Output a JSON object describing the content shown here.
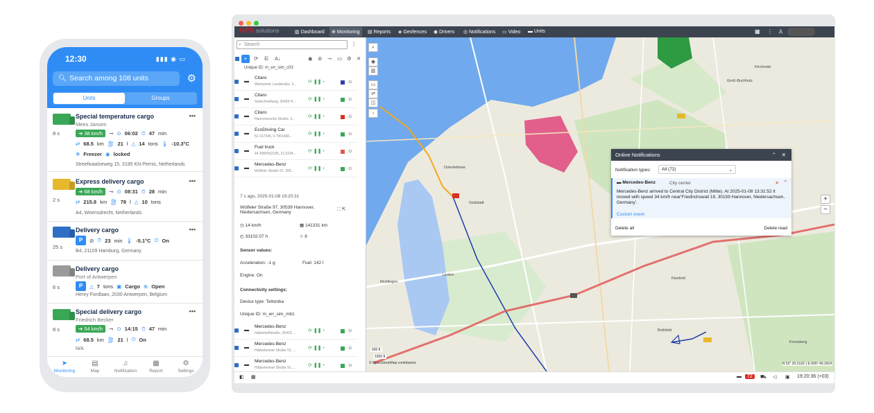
{
  "phone": {
    "time": "12:30",
    "search_placeholder": "Search among 108 units",
    "tabs": [
      "Units",
      "Groups"
    ],
    "cards": [
      {
        "title": "Special temperature cargo",
        "sub": "Mees Jansen",
        "age": "8 s",
        "color": "#3aa756",
        "r1": {
          "speed": "38 km/h",
          "time": "06:02",
          "dur": "47",
          "dur_unit": "min"
        },
        "r2": {
          "dist": "68.5",
          "dist_unit": "km",
          "fuel": "21",
          "fuel_unit": "l",
          "weight": "14",
          "weight_unit": "tons",
          "temp": "-10.3°C"
        },
        "r3": {
          "a": "Freezer",
          "b": "locked"
        },
        "addr": "Streefwaalseweg 15, 3195 KN Pernis, Netherlands"
      },
      {
        "title": "Express delivery cargo",
        "age": "2 s",
        "color": "#e7b82c",
        "r1": {
          "speed": "68 km/h",
          "time": "08:31",
          "dur": "28",
          "dur_unit": "min"
        },
        "r2": {
          "dist": "215.8",
          "dist_unit": "km",
          "fuel": "78",
          "fuel_unit": "l",
          "weight": "10",
          "weight_unit": "tons"
        },
        "addr": "A4, Woensdrecht, Netherlands"
      },
      {
        "title": "Delivery cargo",
        "age": "25 s",
        "color": "#2f6fc5",
        "r1": {
          "park": "P",
          "dur": "23",
          "dur_unit": "min",
          "temp": "-5.1°C",
          "on": "On"
        },
        "addr": "B4, 21109 Hamburg, Germany"
      },
      {
        "title": "Delivery cargo",
        "sub": "Port of Antwerpen",
        "age": "6 s",
        "color": "#9a9a9a",
        "r1": {
          "park": "P",
          "weight": "7",
          "weight_unit": "tons",
          "cargo": "Cargo",
          "open": "Open"
        },
        "addr": "Henry Fordlaan, 2030 Antwerpen, Belgium"
      },
      {
        "title": "Special delivery cargo",
        "sub": "Friedrich Becker",
        "age": "8 s",
        "color": "#3aa756",
        "r1": {
          "speed": "54 km/h",
          "time": "14:15",
          "dur": "47",
          "dur_unit": "min"
        },
        "r2": {
          "dist": "68.5",
          "dist_unit": "km",
          "fuel": "21",
          "fuel_unit": "l",
          "on": "On"
        },
        "addr": "N/A"
      }
    ],
    "nav": [
      "Monitoring",
      "Map",
      "Notification",
      "Report",
      "Settings"
    ]
  },
  "desktop": {
    "logo_a": "GPS",
    "logo_b": "solutions",
    "menu": [
      "Dashboard",
      "Monitoring",
      "Reports",
      "Geofences",
      "Drivers",
      "Notifications",
      "Video",
      "Units"
    ],
    "search_placeholder": "Search",
    "unique_top": "Unique ID: m_en_sim_c03",
    "units": [
      {
        "name": "Citaro",
        "sub": "Weetzener Landstraße, 3...",
        "sq": "#2f3fa8"
      },
      {
        "name": "Citaro",
        "sub": "Südschnellweg, 30459 H...",
        "sq": "#3aa756"
      },
      {
        "name": "Citaro",
        "sub": "Hannoversche Straße, 3...",
        "sq": "#d93025"
      },
      {
        "name": "EcoDriving Car",
        "sub": "52.317345, 9.7951666...",
        "sq": "#3aa756"
      },
      {
        "name": "Fuel truck",
        "sub": "44.4950552185, 21.0234...",
        "sq": "#e05a4a"
      },
      {
        "name": "Mercedes-Benz",
        "sub": "Wülfeler Straße 97, 305...",
        "sq": "#3aa756"
      }
    ],
    "detail": {
      "ago": "7 s ago, 2025-01-08 19:20:31",
      "address": "Wülfeler Straße 97, 30539 Hannover, Niedersachsen, Germany",
      "speed": "14 km/h",
      "odometer": "141331 km",
      "hours": "33102.07 h",
      "sats": "8",
      "sensor_title": "Sensor values:",
      "accel": "Acceleration: -1 g",
      "fuel": "Fuel: 142 l",
      "engine": "Engine: On",
      "conn_title": "Connectivity settings:",
      "device": "Device type: Teltonika",
      "uid": "Unique ID: m_en_sim_mb1"
    },
    "units2": [
      {
        "name": "Mercedes-Benz",
        "sub": "Haltenhoffstraße, 30419 ...",
        "sq": "#3aa756"
      },
      {
        "name": "Mercedes-Benz",
        "sub": "Hildesheimer Straße 91, ...",
        "sq": "#3aa756"
      },
      {
        "name": "Mercedes-Benz",
        "sub": "Hildesheimer Straße 91, ...",
        "sq": "#3aa756"
      },
      {
        "name": "Mercedes-Benz",
        "sub": "",
        "sq": "#3aa756"
      }
    ],
    "notif": {
      "title": "Online Notifications",
      "types_label": "Notification types:",
      "types_value": "All (72)",
      "unit": "Mercedes-Benz",
      "tag": "City center",
      "text": "Mercedes-Benz arrived to Central City District (Mitte). At 2025-01-08 13:31:52 it moved with speed 34 km/h near'Friedrichswall 19, 30159 Hannover, Niedersachsen, Germany'.",
      "custom": "Custom event",
      "delete_all": "Delete all",
      "delete_read": "Delete read"
    },
    "map_labels": [
      "Osterfeldsee",
      "Kirchrode",
      "Südstadt",
      "Bothfeld",
      "Kleefeld",
      "Kronsberg",
      "Wülfel",
      "Ricklingen",
      "Linden",
      "Groß-Buchholz"
    ],
    "scale": [
      "500 ft",
      "1000 ft"
    ],
    "attribution": "© OpenStreetMap contributors",
    "coords": "N 52° 20.2116' | E 009° 49.1814'",
    "badge": "72",
    "clock": "19:20:36 (+03)"
  }
}
